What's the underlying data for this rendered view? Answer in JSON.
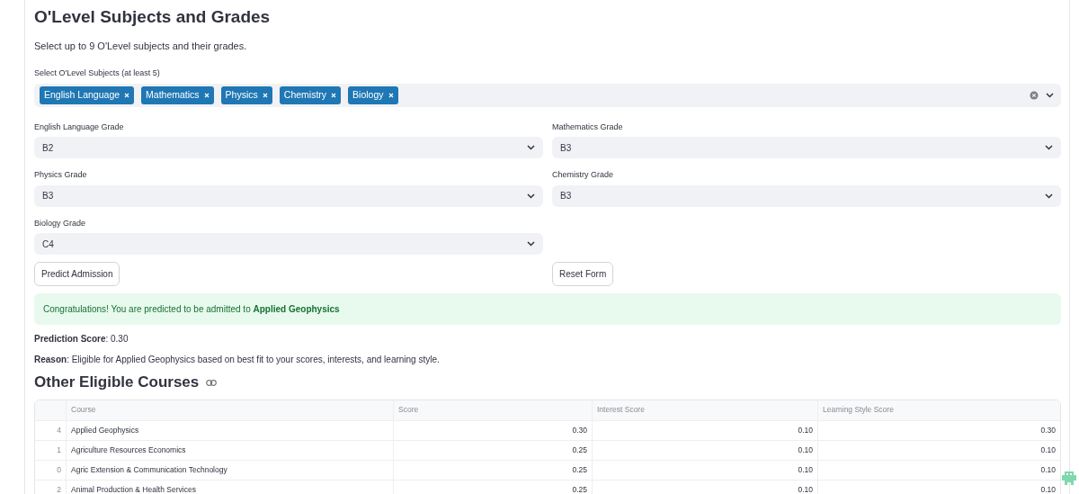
{
  "title": "O'Level Subjects and Grades",
  "intro": "Select up to 9 O'Level subjects and their grades.",
  "subjects_field": {
    "label": "Select O'Level Subjects (at least 5)",
    "tags": [
      "English Language",
      "Mathematics",
      "Physics",
      "Chemistry",
      "Biology"
    ]
  },
  "grades": [
    {
      "label": "English Language Grade",
      "value": "B2"
    },
    {
      "label": "Mathematics Grade",
      "value": "B3"
    },
    {
      "label": "Physics Grade",
      "value": "B3"
    },
    {
      "label": "Chemistry Grade",
      "value": "B3"
    },
    {
      "label": "Biology Grade",
      "value": "C4"
    }
  ],
  "buttons": [
    "Predict Admission",
    "Reset Form"
  ],
  "alert": "Congratulations! You are predicted to be admitted to **Applied Geophysics**",
  "prediction": "**Prediction Score**: 0.30",
  "reason": "**Reason**: Eligible for Applied Geophysics based on best fit to your scores, interests, and learning style.",
  "section_title": "Other Eligible Courses",
  "table": {
    "columns": [
      "Course",
      "Score",
      "Interest Score",
      "Learning Style Score"
    ],
    "rows": [
      {
        "index": "4",
        "cells": [
          "Applied Geophysics",
          "0.30",
          "0.10",
          "0.30"
        ]
      },
      {
        "index": "1",
        "cells": [
          "Agriculture Resources Economics",
          "0.25",
          "0.10",
          "0.10"
        ]
      },
      {
        "index": "0",
        "cells": [
          "Agric Extension & Communication Technology",
          "0.25",
          "0.10",
          "0.10"
        ]
      },
      {
        "index": "2",
        "cells": [
          "Animal Production & Health Services",
          "0.25",
          "0.10",
          "0.10"
        ]
      }
    ]
  }
}
